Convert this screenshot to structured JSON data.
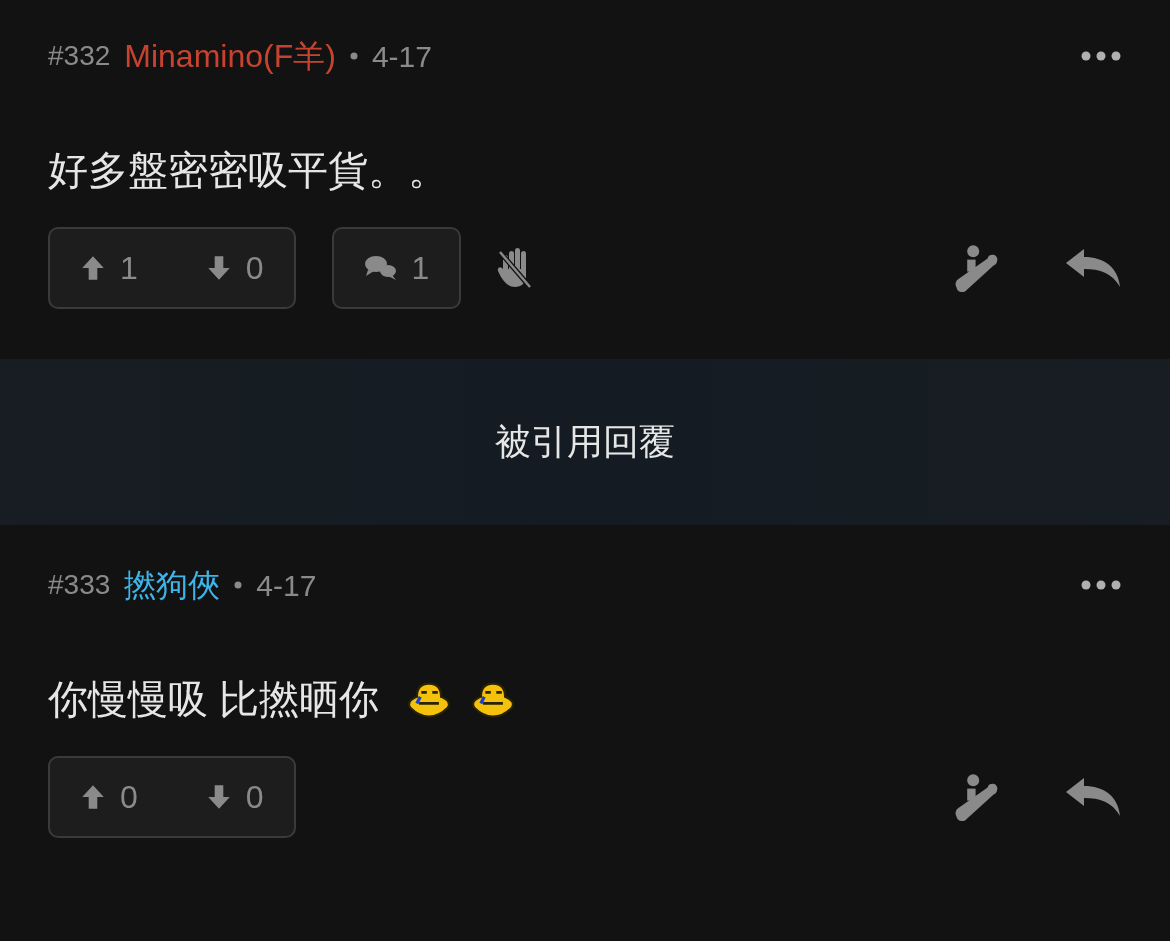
{
  "posts": [
    {
      "number": "#332",
      "author": "Minamino(F羊)",
      "color": "#c8432f",
      "date": "4-17",
      "body": "好多盤密密吸平貨。。",
      "upvotes": "1",
      "downvotes": "0",
      "extras": [
        {
          "kind": "replies",
          "count": "1"
        },
        {
          "kind": "hide"
        }
      ]
    },
    {
      "number": "#333",
      "author": "撚狗俠",
      "color": "#3fb4e8",
      "date": "4-17",
      "body": "你慢慢吸 比撚晒你",
      "emoticons": [
        {
          "kind": "crying"
        },
        {
          "kind": "crying"
        }
      ],
      "upvotes": "0",
      "downvotes": "0"
    }
  ],
  "banner": {
    "label": "被引用回覆"
  }
}
